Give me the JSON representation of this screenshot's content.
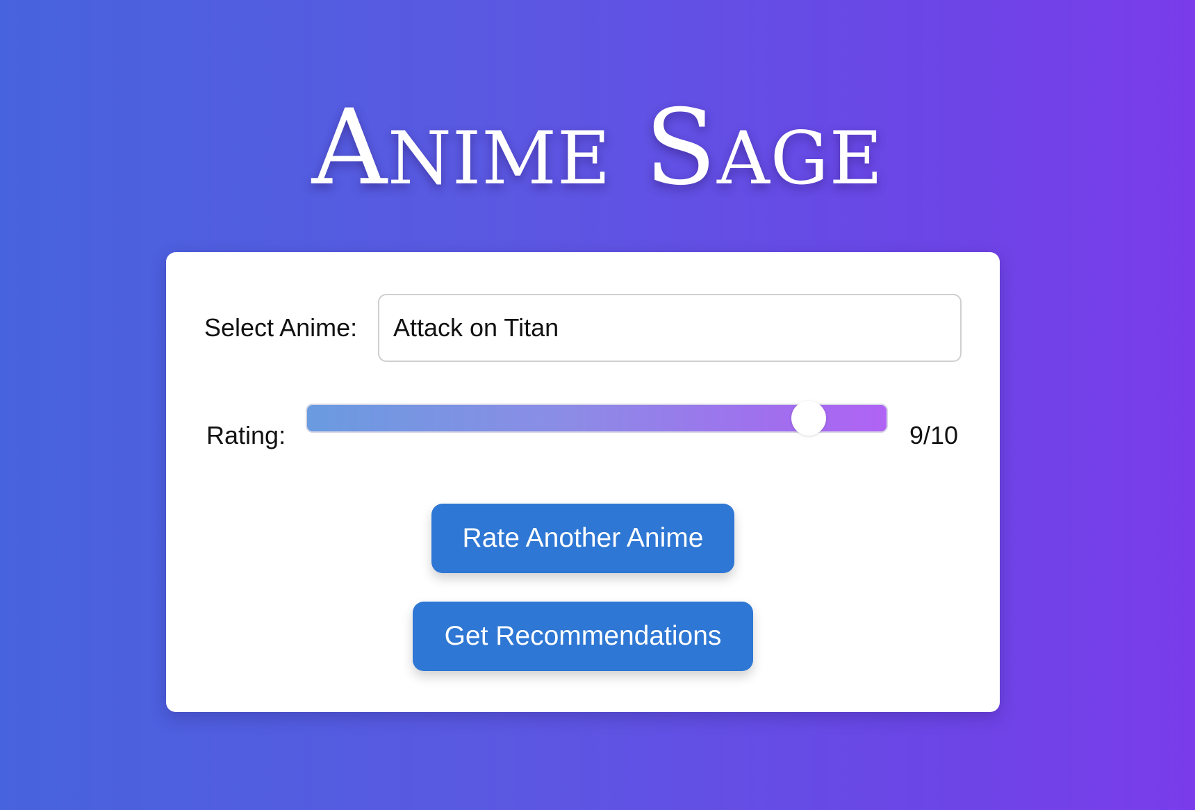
{
  "app": {
    "title": "Anime Sage"
  },
  "form": {
    "select_label": "Select Anime:",
    "anime_value": "Attack on Titan",
    "rating_label": "Rating:",
    "rating_value": 9,
    "rating_max": 10,
    "rating_display": "9/10"
  },
  "buttons": {
    "rate_another": "Rate Another Anime",
    "get_recommendations": "Get Recommendations"
  },
  "colors": {
    "button_bg": "#2e77d4",
    "background_start": "#4763dd",
    "background_end": "#7a3cea",
    "slider_start": "#6a9be0",
    "slider_end": "#b063f4"
  }
}
